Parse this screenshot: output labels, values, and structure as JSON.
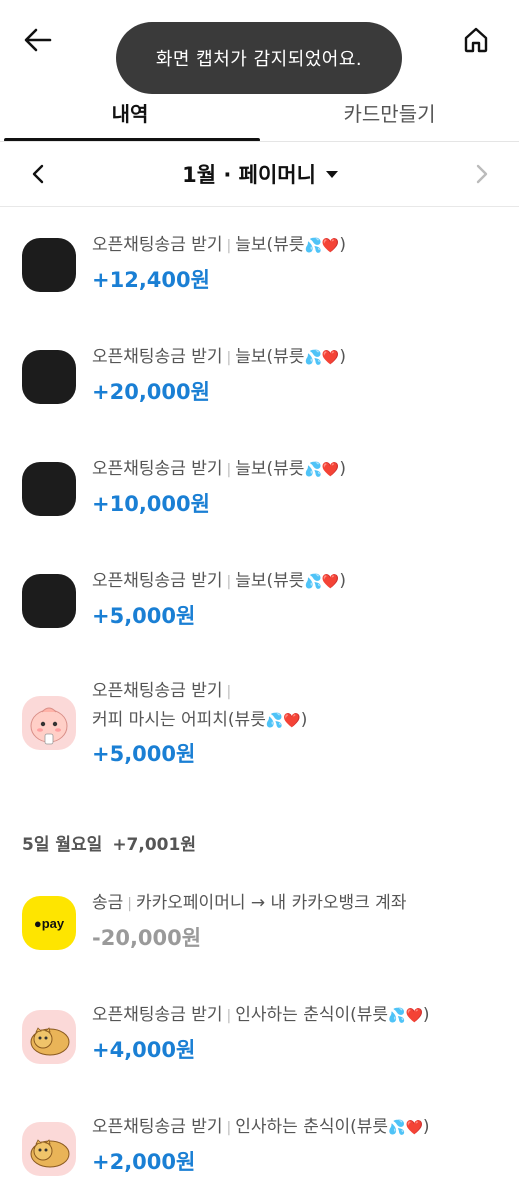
{
  "header": {
    "back_icon": "arrow-left-icon",
    "home_icon": "home-icon"
  },
  "toast": {
    "text": "화면 캡처가 감지되었어요."
  },
  "tabs": [
    {
      "label": "내역",
      "active": true
    },
    {
      "label": "카드만들기",
      "active": false
    }
  ],
  "month_bar": {
    "label": "1월 · 페이머니",
    "prev_icon": "chevron-left-icon",
    "next_icon": "chevron-right-icon"
  },
  "transactions_top": [
    {
      "type": "오픈채팅송금 받기",
      "name": "늘보(뷰릇",
      "emoji": "💦❤️",
      "amount": "+12,400원",
      "avatar": "black"
    },
    {
      "type": "오픈채팅송금 받기",
      "name": "늘보(뷰릇",
      "emoji": "💦❤️",
      "amount": "+20,000원",
      "avatar": "black"
    },
    {
      "type": "오픈채팅송금 받기",
      "name": "늘보(뷰릇",
      "emoji": "💦❤️",
      "amount": "+10,000원",
      "avatar": "black"
    },
    {
      "type": "오픈채팅송금 받기",
      "name": "늘보(뷰릇",
      "emoji": "💦❤️",
      "amount": "+5,000원",
      "avatar": "black"
    },
    {
      "type": "오픈채팅송금 받기",
      "name": "커피 마시는 어피치(뷰릇",
      "emoji": "💦❤️",
      "amount": "+5,000원",
      "avatar": "apeach"
    }
  ],
  "date_group": {
    "date": "5일 월요일",
    "total": "+7,001원"
  },
  "transactions_bottom": [
    {
      "type": "송금",
      "name": "카카오페이머니 → 내 카카오뱅크 계좌",
      "emoji": "",
      "amount": "-20,000원",
      "avatar": "pay",
      "avatar_label": "●pay"
    },
    {
      "type": "오픈채팅송금 받기",
      "name": "인사하는 춘식이(뷰릇",
      "emoji": "💦❤️",
      "amount": "+4,000원",
      "avatar": "choonsik"
    },
    {
      "type": "오픈채팅송금 받기",
      "name": "인사하는 춘식이(뷰릇",
      "emoji": "💦❤️",
      "amount": "+2,000원",
      "avatar": "choonsik"
    }
  ],
  "colors": {
    "plus": "#1a7fd4",
    "minus": "#9a9a9a",
    "pay_yellow": "#fee500",
    "toast_bg": "#3a3a3a"
  }
}
